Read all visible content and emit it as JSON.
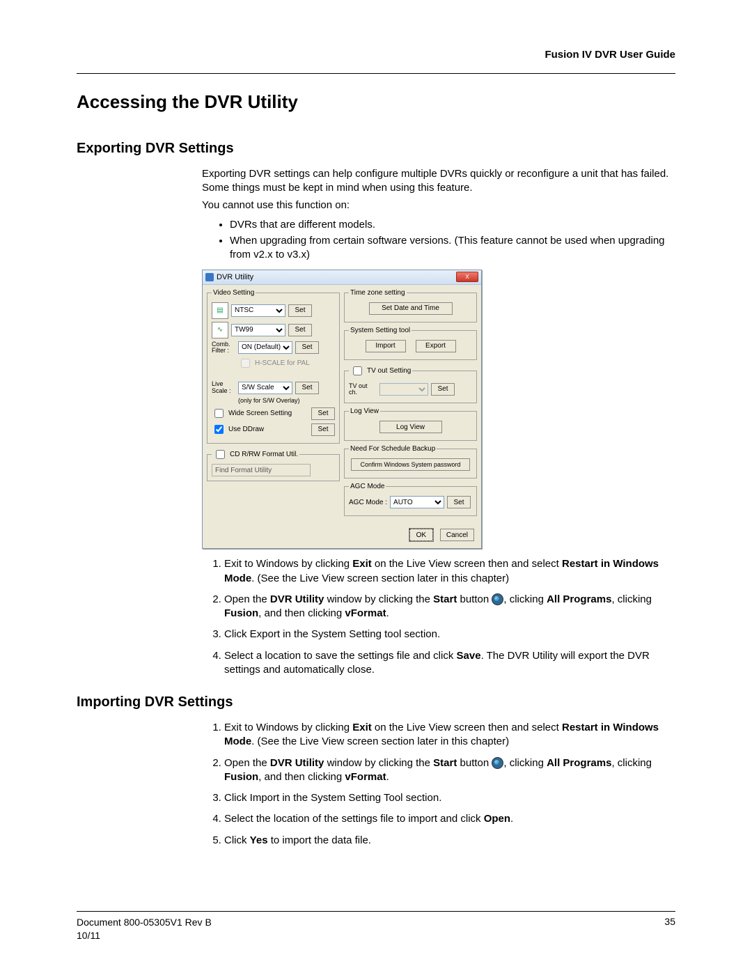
{
  "header": {
    "doc_title": "Fusion IV DVR User Guide"
  },
  "h1": "Accessing the DVR Utility",
  "section_export": {
    "title": "Exporting DVR Settings",
    "intro_l1": "Exporting DVR settings can help configure multiple DVRs quickly or reconfigure a unit that has failed. Some things must be kept in mind when using this feature.",
    "intro_l2": "You cannot use this function on:",
    "bullets": [
      "DVRs that are different models.",
      "When upgrading from certain software versions. (This feature cannot be used when upgrading from v2.x to v3.x)"
    ],
    "steps": {
      "s1a": "Exit to Windows by clicking ",
      "s1b": "Exit",
      "s1c": " on the Live View screen then and select ",
      "s1d": "Restart in Windows Mode",
      "s1e": ". (See the Live View screen section later in this chapter)",
      "s2a": "Open the ",
      "s2b": "DVR Utility",
      "s2c": " window by clicking the ",
      "s2d": "Start",
      "s2e": " button ",
      "s2f": ", clicking ",
      "s2g": "All Programs",
      "s2h": ", clicking ",
      "s2i": "Fusion",
      "s2j": ", and then clicking ",
      "s2k": "vFormat",
      "s2l": ".",
      "s3": "Click Export in the System Setting tool section.",
      "s4a": "Select a location to save the settings file and click ",
      "s4b": "Save",
      "s4c": ". The DVR Utility will export the DVR settings and automatically close."
    }
  },
  "section_import": {
    "title": "Importing DVR Settings",
    "s1a": "Exit to Windows by clicking ",
    "s1b": "Exit",
    "s1c": " on the Live View screen then and select ",
    "s1d": "Restart in Windows Mode",
    "s1e": ". (See the Live View screen section later in this chapter)",
    "s2pre": "2.",
    "s2a": "Open the ",
    "s2b": "DVR Utility",
    "s2c": " window by clicking the ",
    "s2d": "Start",
    "s2e": " button ",
    "s2f": ", clicking ",
    "s2g": "All Programs",
    "s2h": ", clicking ",
    "s2i": "Fusion",
    "s2j": ", and then clicking ",
    "s2k": "vFormat",
    "s2l": ".",
    "s3": "Click Import in the System Setting Tool section.",
    "s4a": "Select the location of the settings file to import and click ",
    "s4b": "Open",
    "s4c": ".",
    "s5a": "Click ",
    "s5b": "Yes",
    "s5c": " to import the data file."
  },
  "dialog": {
    "title": "DVR Utility",
    "close": "X",
    "video_setting": {
      "legend": "Video Setting",
      "ntsc": "NTSC",
      "tw99": "TW99",
      "comb_label": "Comb. Filter :",
      "comb_value": "ON (Default)",
      "hscale_label": "H-SCALE for PAL",
      "live_label": "Live Scale :",
      "live_value": "S/W Scale",
      "live_note": "(only for S/W Overlay)",
      "wide_label": "Wide Screen Setting",
      "ddraw_label": "Use DDraw",
      "set": "Set"
    },
    "cd": {
      "legend": "CD R/RW Format Util.",
      "text": "Find Format Utility"
    },
    "tz": {
      "legend": "Time zone setting",
      "btn": "Set Date and Time"
    },
    "sys": {
      "legend": "System Setting tool",
      "import": "Import",
      "export": "Export"
    },
    "tv": {
      "legend": "TV out Setting",
      "label": "TV out ch.",
      "set": "Set"
    },
    "log": {
      "legend": "Log View",
      "btn": "Log View"
    },
    "sched": {
      "legend": "Need For Schedule Backup",
      "btn": "Confirm Windows System password"
    },
    "agc": {
      "legend": "AGC Mode",
      "label": "AGC Mode :",
      "value": "AUTO",
      "set": "Set"
    },
    "footer": {
      "ok": "OK",
      "cancel": "Cancel"
    }
  },
  "footer": {
    "doc_id": "Document 800-05305V1 Rev B",
    "date": "10/11",
    "page": "35"
  }
}
